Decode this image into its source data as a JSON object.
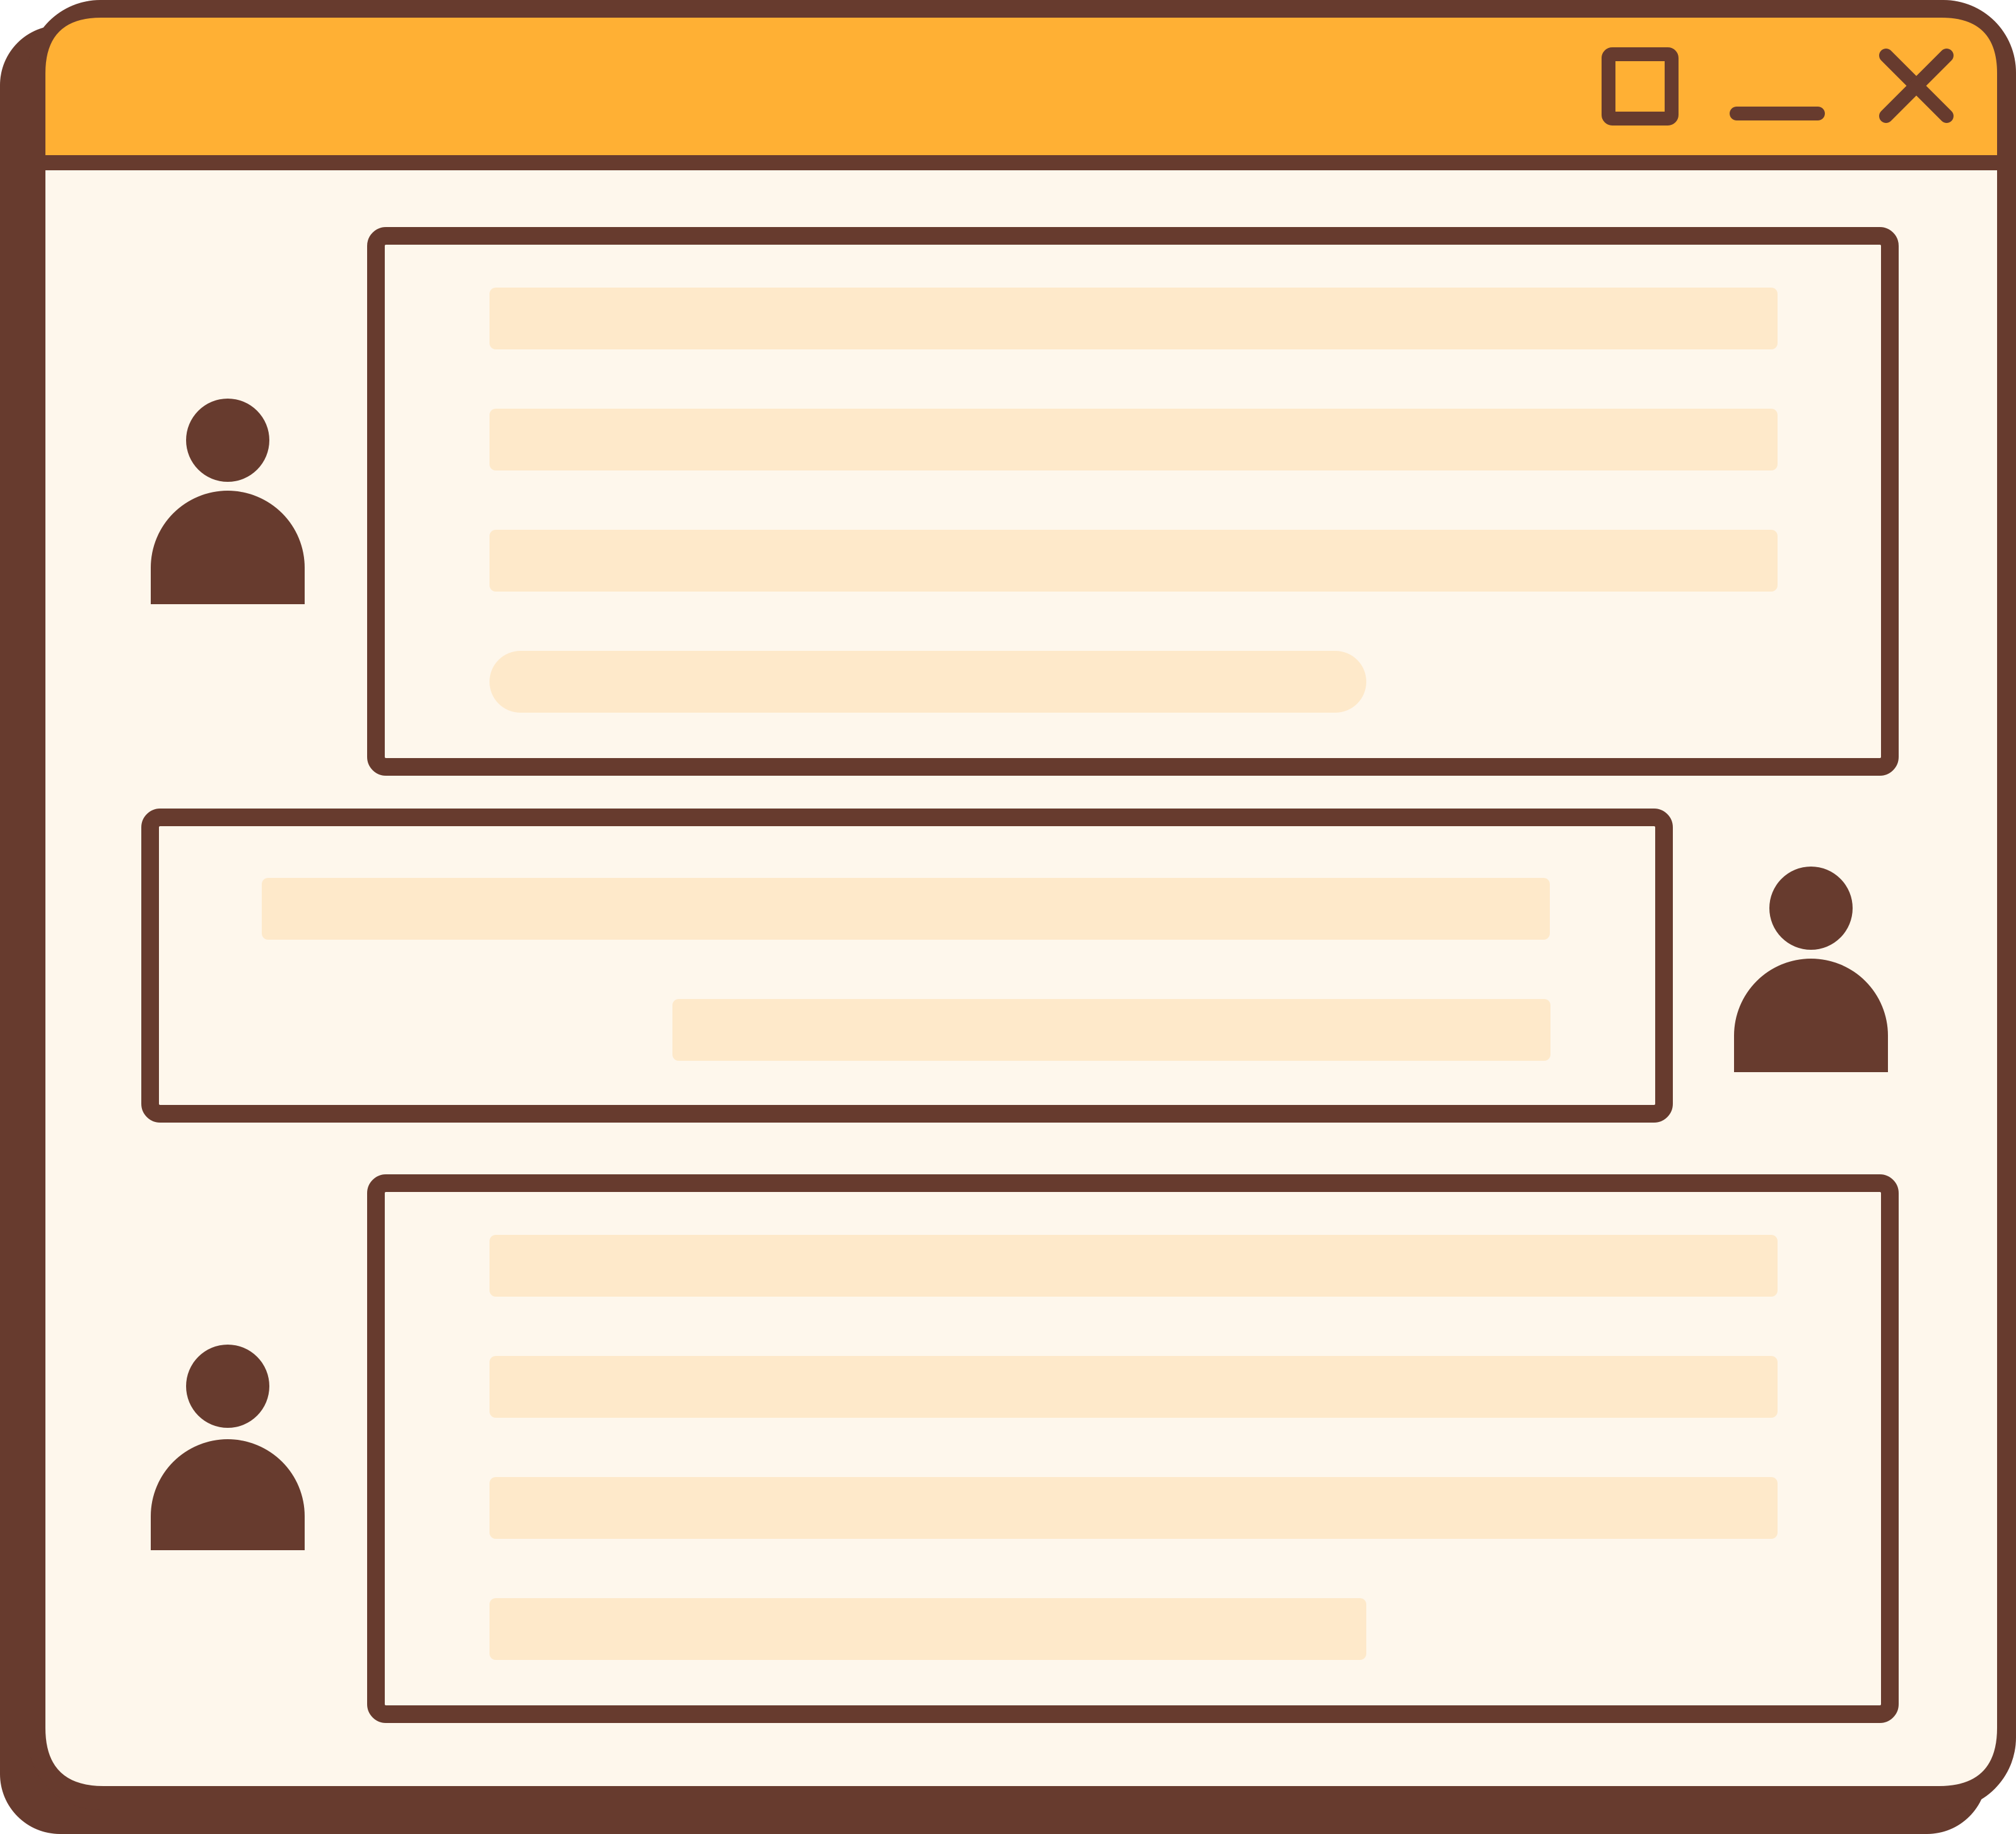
{
  "colors": {
    "outline": "#673b2e",
    "titlebar": "#ffb034",
    "window_bg": "#fef7ec",
    "placeholder_bar": "#fee9ca",
    "page_bg": "#ffffff"
  },
  "window": {
    "title": "",
    "controls": [
      "maximize-icon",
      "minimize-icon",
      "close-icon"
    ]
  },
  "messages": [
    {
      "sender": "left",
      "avatar": "user-avatar-icon",
      "text_lines": 4
    },
    {
      "sender": "right",
      "avatar": "user-avatar-icon",
      "text_lines": 2
    },
    {
      "sender": "left",
      "avatar": "user-avatar-icon",
      "text_lines": 4
    }
  ]
}
